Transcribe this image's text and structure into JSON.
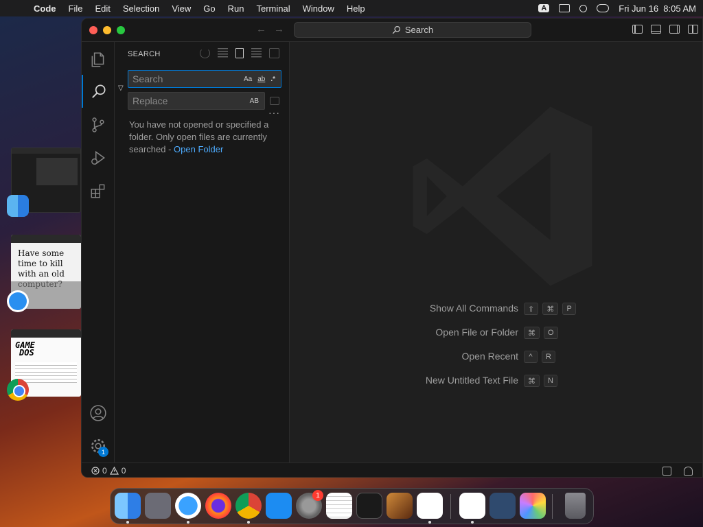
{
  "menubar": {
    "app_name": "Code",
    "items": [
      "File",
      "Edit",
      "Selection",
      "View",
      "Go",
      "Run",
      "Terminal",
      "Window",
      "Help"
    ],
    "input_source": "A",
    "datetime": "Fri Jun 16  8:05 AM"
  },
  "desktop_thumbs": {
    "safari_text": "Have some time to kill with an old computer?",
    "game_logo_line1": "GAME",
    "game_logo_line2": "DOS"
  },
  "titlebar": {
    "search_label": "Search"
  },
  "activitybar": {
    "items": [
      "explorer-icon",
      "search-icon",
      "source-control-icon",
      "run-debug-icon",
      "extensions-icon"
    ],
    "account_icon": "account-icon",
    "settings_icon": "gear-icon",
    "settings_badge": "1"
  },
  "sidebar": {
    "title": "SEARCH",
    "search_placeholder": "Search",
    "replace_placeholder": "Replace",
    "match_case": "Aa",
    "whole_word": "ab",
    "regex": ".*",
    "preserve_case": "AB",
    "message_text": "You have not opened or specified a folder. Only open files are currently searched - ",
    "message_link": "Open Folder",
    "more": "···"
  },
  "editor": {
    "shortcuts": [
      {
        "label": "Show All Commands",
        "keys": [
          "⇧",
          "⌘",
          "P"
        ]
      },
      {
        "label": "Open File or Folder",
        "keys": [
          "⌘",
          "O"
        ]
      },
      {
        "label": "Open Recent",
        "keys": [
          "^",
          "R"
        ]
      },
      {
        "label": "New Untitled Text File",
        "keys": [
          "⌘",
          "N"
        ]
      }
    ]
  },
  "statusbar": {
    "errors": "0",
    "warnings": "0"
  },
  "dock": {
    "apps": [
      "Finder",
      "Launchpad",
      "Safari",
      "Firefox",
      "Chrome",
      "App Store",
      "System Settings",
      "TextEdit",
      "Terminal",
      "GarageBand",
      "Visual Studio Code",
      "Visual Studio",
      "Xcode Tools",
      "Photos",
      "Trash"
    ],
    "settings_badge": "1"
  },
  "colors": {
    "accent": "#0078d4",
    "link": "#4daafc",
    "window_bg": "#1f1f1f",
    "sidebar_bg": "#181818"
  }
}
